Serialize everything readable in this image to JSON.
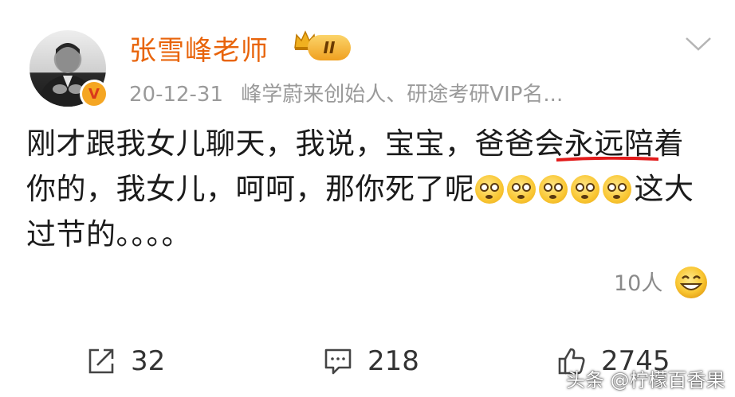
{
  "post": {
    "author": "张雪峰老师",
    "level_badge": "II",
    "date": "20-12-31",
    "source": "峰学蔚来创始人、研途考研VIP名...",
    "content_lines": [
      "刚才跟我女儿聊天，我说，宝宝，爸爸会永远陪着",
      "你的，我女儿，呵呵，那你死了呢",
      "这大",
      "过节的。。。。"
    ],
    "emoji_count": 5,
    "emoji_icon": "dizzy-face-icon",
    "likers_text": "10人"
  },
  "actions": {
    "repost_count": "32",
    "comment_count": "218",
    "like_count": "2745"
  },
  "watermark": "头条 @柠檬百香果",
  "colors": {
    "author": "#e8640b",
    "underline": "#e21b1b",
    "meta": "#9a9a9a"
  }
}
